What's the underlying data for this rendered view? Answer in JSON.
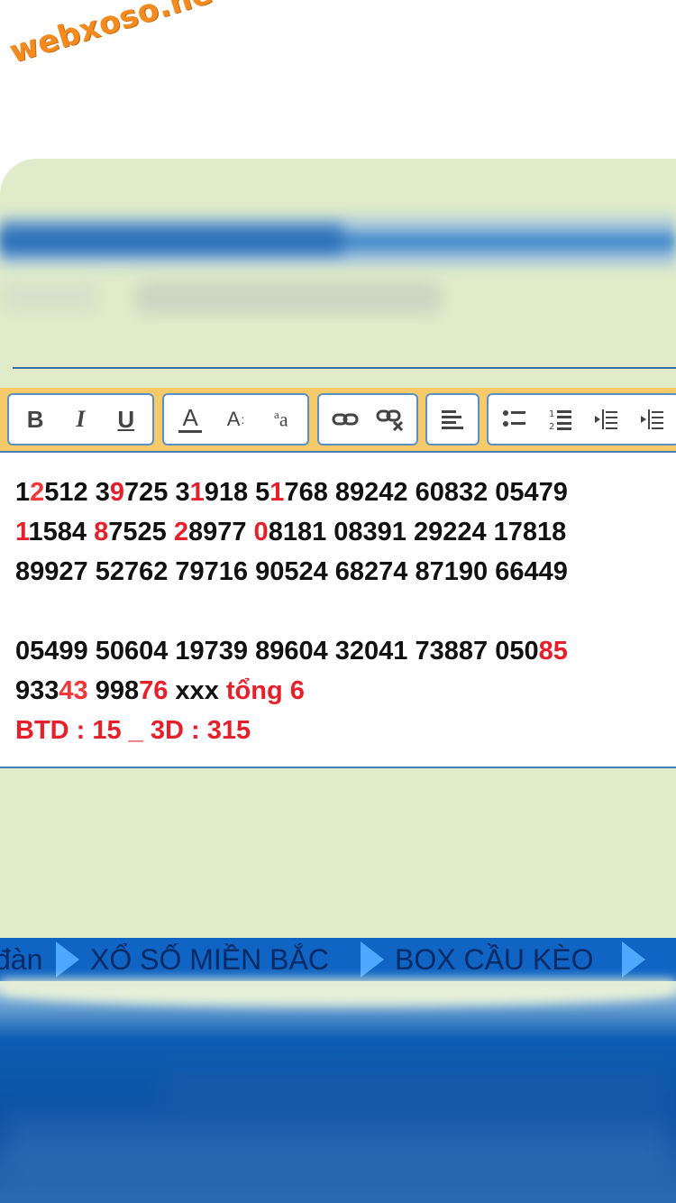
{
  "watermark": "webxoso.net",
  "toolbar": {
    "groups": [
      {
        "name": "text-style",
        "buttons": [
          "bold",
          "italic",
          "underline"
        ]
      },
      {
        "name": "text-color",
        "buttons": [
          "font-color",
          "font-size",
          "subscript"
        ]
      },
      {
        "name": "links",
        "buttons": [
          "link",
          "unlink"
        ]
      },
      {
        "name": "align",
        "buttons": [
          "align-left"
        ]
      },
      {
        "name": "lists",
        "buttons": [
          "bullet-list",
          "numbered-list",
          "outdent",
          "indent"
        ]
      }
    ],
    "bold_label": "B",
    "italic_label": "I",
    "underline_label": "U",
    "font_color_label": "A",
    "font_size_label": "A",
    "subscript_label": "aa"
  },
  "editor": {
    "lines": [
      [
        {
          "t": "1",
          "c": "black"
        },
        {
          "t": "2",
          "c": "red-light"
        },
        {
          "t": "512 3",
          "c": "black"
        },
        {
          "t": "9",
          "c": "red"
        },
        {
          "t": "725 3",
          "c": "black"
        },
        {
          "t": "1",
          "c": "red"
        },
        {
          "t": "918 5",
          "c": "black"
        },
        {
          "t": "1",
          "c": "red"
        },
        {
          "t": "768 89242 60832 05479",
          "c": "black"
        }
      ],
      [
        {
          "t": "1",
          "c": "red"
        },
        {
          "t": "1584 ",
          "c": "black"
        },
        {
          "t": "8",
          "c": "red"
        },
        {
          "t": "7525 ",
          "c": "black"
        },
        {
          "t": "2",
          "c": "red"
        },
        {
          "t": "8977 ",
          "c": "black"
        },
        {
          "t": "0",
          "c": "red"
        },
        {
          "t": "8181 08391 29224 17818",
          "c": "black"
        }
      ],
      [
        {
          "t": "89927 52762 79716 90524 68274 87190 66449",
          "c": "black"
        }
      ],
      [],
      [
        {
          "t": "05499 50604 19739 89604 32041 73887 050",
          "c": "black"
        },
        {
          "t": "85",
          "c": "red"
        }
      ],
      [
        {
          "t": "933",
          "c": "black"
        },
        {
          "t": "43",
          "c": "red-light"
        },
        {
          "t": " 998",
          "c": "black"
        },
        {
          "t": "76",
          "c": "red"
        },
        {
          "t": " xxx ",
          "c": "black"
        },
        {
          "t": "tổng 6",
          "c": "red"
        }
      ],
      [
        {
          "t": "BTD : 15 _ 3D : 315",
          "c": "red"
        }
      ]
    ]
  },
  "nav": {
    "items": [
      "đàn",
      "XỔ SỐ MIỀN BẮC",
      "BOX CẦU KÈO"
    ]
  },
  "colors": {
    "red": "#e5202a",
    "red_light": "#f03838",
    "green_bg": "#e0ecc9",
    "toolbar_bg": "#f6c969",
    "nav_bg": "#0f64c4",
    "nav_text": "#0a2a66",
    "watermark": "#f58a1f"
  }
}
